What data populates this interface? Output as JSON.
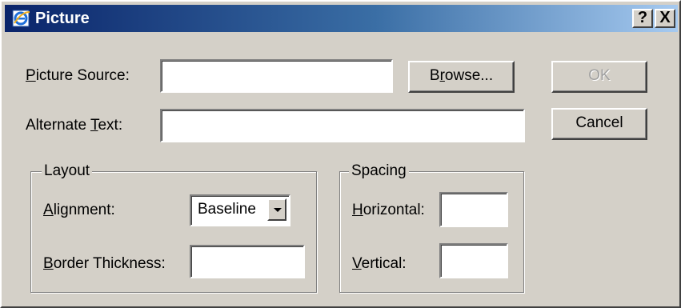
{
  "window": {
    "title": "Picture",
    "help_label": "?",
    "close_label": "X"
  },
  "picture_source": {
    "label_accel": "P",
    "label_rest": "icture Source:",
    "value": ""
  },
  "browse_button": {
    "pre": "B",
    "accel": "r",
    "post": "owse..."
  },
  "ok_button": {
    "label": "OK",
    "enabled": false
  },
  "cancel_button": {
    "label": "Cancel"
  },
  "alternate_text": {
    "label_pre": "Alternate ",
    "label_accel": "T",
    "label_post": "ext:",
    "value": ""
  },
  "layout_group": {
    "legend": "Layout",
    "alignment": {
      "label_accel": "A",
      "label_rest": "lignment:",
      "value": "Baseline"
    },
    "border_thickness": {
      "label_accel": "B",
      "label_rest": "order Thickness:",
      "value": ""
    }
  },
  "spacing_group": {
    "legend": "Spacing",
    "horizontal": {
      "label_accel": "H",
      "label_rest": "orizontal:",
      "value": ""
    },
    "vertical": {
      "label_accel": "V",
      "label_rest": "ertical:",
      "value": ""
    }
  },
  "colors": {
    "title_start": "#0a246a",
    "title_end": "#a6caf0",
    "face": "#d4d0c8"
  }
}
